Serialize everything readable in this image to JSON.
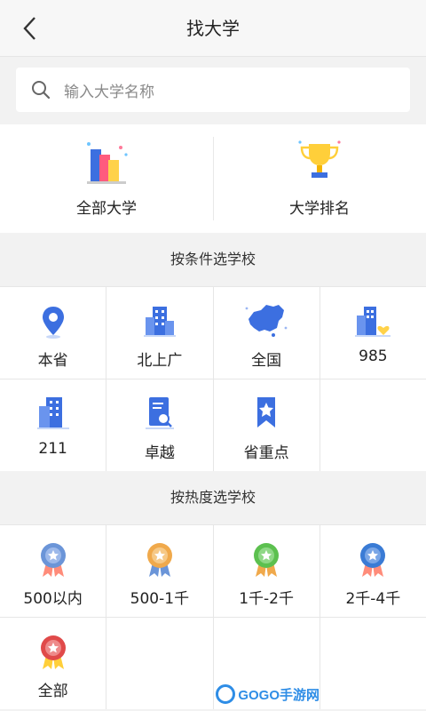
{
  "header": {
    "title": "找大学"
  },
  "search": {
    "placeholder": "输入大学名称"
  },
  "top_categories": [
    {
      "label": "全部大学",
      "icon": "buildings-chart-icon"
    },
    {
      "label": "大学排名",
      "icon": "trophy-icon"
    }
  ],
  "section_condition": {
    "title": "按条件选学校"
  },
  "condition_items": [
    {
      "label": "本省",
      "icon": "location-pin-icon"
    },
    {
      "label": "北上广",
      "icon": "city-building-icon"
    },
    {
      "label": "全国",
      "icon": "china-map-icon"
    },
    {
      "label": "985",
      "icon": "building-heart-icon"
    },
    {
      "label": "211",
      "icon": "building-block-icon"
    },
    {
      "label": "卓越",
      "icon": "document-search-icon"
    },
    {
      "label": "省重点",
      "icon": "star-bookmark-icon"
    }
  ],
  "section_heat": {
    "title": "按热度选学校"
  },
  "heat_items": [
    {
      "label": "500以内",
      "icon": "medal-blue-icon",
      "color": "#6b95d8"
    },
    {
      "label": "500-1千",
      "icon": "medal-orange-icon",
      "color": "#f0a94b"
    },
    {
      "label": "1千-2千",
      "icon": "medal-green-icon",
      "color": "#5cc04f"
    },
    {
      "label": "2千-4千",
      "icon": "medal-darkblue-icon",
      "color": "#3a7bd5"
    },
    {
      "label": "全部",
      "icon": "medal-red-icon",
      "color": "#e04a4a"
    }
  ],
  "watermark": {
    "text": "GOGO手游网"
  }
}
